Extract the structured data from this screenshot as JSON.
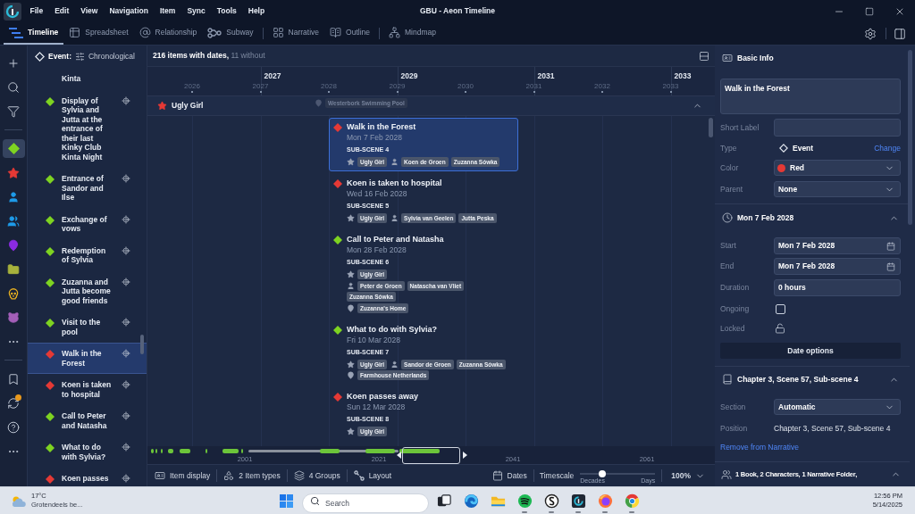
{
  "window": {
    "title": "GBU - Aeon Timeline"
  },
  "menu": [
    "File",
    "Edit",
    "View",
    "Navigation",
    "Item",
    "Sync",
    "Tools",
    "Help"
  ],
  "view_tabs": [
    [
      {
        "kind": "timeline",
        "label": "Timeline",
        "selected": true
      },
      {
        "kind": "spreadsheet",
        "label": "Spreadsheet",
        "selected": false
      },
      {
        "kind": "relationship",
        "label": "Relationship",
        "selected": false
      },
      {
        "kind": "subway",
        "label": "Subway",
        "selected": false
      }
    ],
    [
      {
        "kind": "narrative",
        "label": "Narrative",
        "selected": false
      },
      {
        "kind": "outline",
        "label": "Outline",
        "selected": false
      }
    ],
    [
      {
        "kind": "mindmap",
        "label": "Mindmap",
        "selected": false
      }
    ]
  ],
  "rail": {
    "filters": [
      {
        "kind": "diamond",
        "color": "#7ed321",
        "selected": true
      },
      {
        "kind": "star",
        "color": "#e53935",
        "selected": false
      },
      {
        "kind": "person",
        "color": "#1e9be9",
        "selected": false
      },
      {
        "kind": "people",
        "color": "#1e9be9",
        "selected": false
      },
      {
        "kind": "pin",
        "color": "#8b2be2",
        "selected": false
      },
      {
        "kind": "folder",
        "color": "#a7b23c",
        "selected": false
      },
      {
        "kind": "skull",
        "color": "#e8b020",
        "selected": false
      },
      {
        "kind": "cat",
        "color": "#a35fb8",
        "selected": false
      }
    ],
    "sync_alert": true
  },
  "event_list": {
    "type": "Event:",
    "sort": "Chronological",
    "items": [
      {
        "title": "Kinta",
        "selected": false
      },
      {
        "title": "Display of Sylvia and Jutta at the entrance of their last Kinky Club Kinta Night",
        "color": "#7ed321",
        "selected": false
      },
      {
        "title": "Entrance of Sandor and Ilse",
        "color": "#7ed321",
        "selected": false
      },
      {
        "title": "Exchange of vows",
        "color": "#7ed321",
        "selected": false
      },
      {
        "title": "Redemption of Sylvia",
        "color": "#7ed321",
        "selected": false
      },
      {
        "title": "Zuzanna and Jutta become good friends",
        "color": "#7ed321",
        "selected": false
      },
      {
        "title": "Visit to the pool",
        "color": "#7ed321",
        "selected": false
      },
      {
        "title": "Walk in the Forest",
        "color": "#e53935",
        "selected": true
      },
      {
        "title": "Koen is taken to hospital",
        "color": "#e53935",
        "selected": false
      },
      {
        "title": "Call to Peter and Natasha",
        "color": "#7ed321",
        "selected": false
      },
      {
        "title": "What to do with Sylvia?",
        "color": "#7ed321",
        "selected": false
      },
      {
        "title": "Koen passes",
        "color": "#e53935",
        "selected": false
      }
    ]
  },
  "timeline": {
    "summary": "**216 items with dates,** 11 without",
    "ruler": {
      "major": [
        "2027",
        "2029",
        "2031",
        "2033"
      ],
      "minor": [
        "2026",
        "2027",
        "2028",
        "2029",
        "2030",
        "2031",
        "2032",
        "2033"
      ]
    },
    "lane": {
      "title": "Ugly Girl",
      "expanded": true,
      "faint_tag": "Westerbork Swimming Pool"
    },
    "events": [
      {
        "title": "Walk in the Forest",
        "date": "Mon 7 Feb 2028",
        "scene": "SUB-SCENE 4",
        "color": "#e53935",
        "selected": true,
        "tag_groups": [
          {
            "kind": "arc",
            "tags": [
              "Ugly Girl"
            ]
          },
          {
            "kind": "person",
            "tags": [
              "Koen de Groen",
              "Zuzanna Sówka"
            ]
          }
        ]
      },
      {
        "title": "Koen is taken to hospital",
        "date": "Wed 16 Feb 2028",
        "scene": "SUB-SCENE 5",
        "color": "#e53935",
        "selected": false,
        "tag_groups": [
          {
            "kind": "arc",
            "tags": [
              "Ugly Girl"
            ]
          },
          {
            "kind": "person",
            "tags": [
              "Sylvia van Geelen",
              "Jutta Peska"
            ]
          }
        ]
      },
      {
        "title": "Call to Peter and Natasha",
        "date": "Mon 28 Feb 2028",
        "scene": "SUB-SCENE 6",
        "color": "#7ed321",
        "selected": false,
        "tag_groups": [
          {
            "kind": "arc",
            "tags": [
              "Ugly Girl"
            ]
          },
          {
            "kind": "person",
            "tags": [
              "Peter de Groen",
              "Natascha van Vliet",
              "Zuzanna Sówka"
            ]
          },
          {
            "kind": "place",
            "tags": [
              "Zuzanna's Home"
            ]
          }
        ]
      },
      {
        "title": "What to do with Sylvia?",
        "date": "Fri 10 Mar 2028",
        "scene": "SUB-SCENE 7",
        "color": "#7ed321",
        "selected": false,
        "tag_groups": [
          {
            "kind": "arc",
            "tags": [
              "Ugly Girl"
            ]
          },
          {
            "kind": "person",
            "tags": [
              "Sandor de Groen",
              "Zuzanna Sówka"
            ]
          },
          {
            "kind": "place",
            "tags": [
              "Farmhouse Netherlands"
            ]
          }
        ]
      },
      {
        "title": "Koen passes away",
        "date": "Sun 12 Mar 2028",
        "scene": "SUB-SCENE 8",
        "color": "#e53935",
        "selected": false,
        "tag_groups": [
          {
            "kind": "arc",
            "tags": [
              "Ugly Girl"
            ]
          }
        ]
      }
    ],
    "overview": {
      "years": [
        "2001",
        "2021",
        "2041",
        "2061"
      ]
    }
  },
  "footer": {
    "tools": [
      {
        "kind": "card",
        "label": "Item display"
      },
      {
        "kind": "shapes",
        "label": "2 Item types"
      },
      {
        "kind": "layers",
        "label": "4 Groups"
      },
      {
        "kind": "layout",
        "label": "Layout"
      }
    ],
    "dates": "Dates",
    "timescale": {
      "label": "Timescale",
      "min_label": "Decades",
      "max_label": "Days",
      "level": 0.27
    },
    "zoom": "100%"
  },
  "inspector": {
    "basic": {
      "heading": "Basic Info",
      "name": "Walk in the Forest",
      "short_label": "Short Label",
      "type": {
        "label": "Type",
        "value": "Event",
        "action": "Change"
      },
      "color": {
        "label": "Color",
        "value": "Red"
      },
      "parent": {
        "label": "Parent",
        "value": "None"
      }
    },
    "dates": {
      "heading": "Mon 7 Feb 2028",
      "expanded": true,
      "start": {
        "label": "Start",
        "value": "Mon 7 Feb 2028"
      },
      "end": {
        "label": "End",
        "value": "Mon 7 Feb 2028"
      },
      "duration": {
        "label": "Duration",
        "value": "0 hours"
      },
      "ongoing": {
        "label": "Ongoing",
        "checked": false
      },
      "locked": {
        "label": "Locked",
        "locked": false
      },
      "options_button": "Date options"
    },
    "narrative": {
      "heading": "Chapter 3, Scene 57, Sub-scene 4",
      "expanded": true,
      "section": {
        "label": "Section",
        "value": "Automatic"
      },
      "position": {
        "label": "Position",
        "value": "Chapter 3, Scene 57, Sub-scene 4"
      },
      "remove_link": "Remove from Narrative"
    },
    "relations": {
      "heading": "1 Book, 2 Characters, 1 Narrative Folder,",
      "expanded": true
    }
  },
  "taskbar": {
    "weather": {
      "temperature": "17°C",
      "condition": "Grotendeels be..."
    },
    "search": {
      "placeholder": "Search"
    },
    "apps": [
      {
        "kind": "task_view",
        "running": false
      },
      {
        "kind": "swirl",
        "running": false
      },
      {
        "kind": "folder",
        "running": false
      },
      {
        "kind": "curves",
        "running": true
      },
      {
        "kind": "s_circle",
        "running": true
      },
      {
        "kind": "ring_tile",
        "running": true
      },
      {
        "kind": "globe",
        "running": true
      },
      {
        "kind": "segments",
        "running": true
      }
    ],
    "time": "12:56 PM",
    "date": "5/14/2025"
  }
}
